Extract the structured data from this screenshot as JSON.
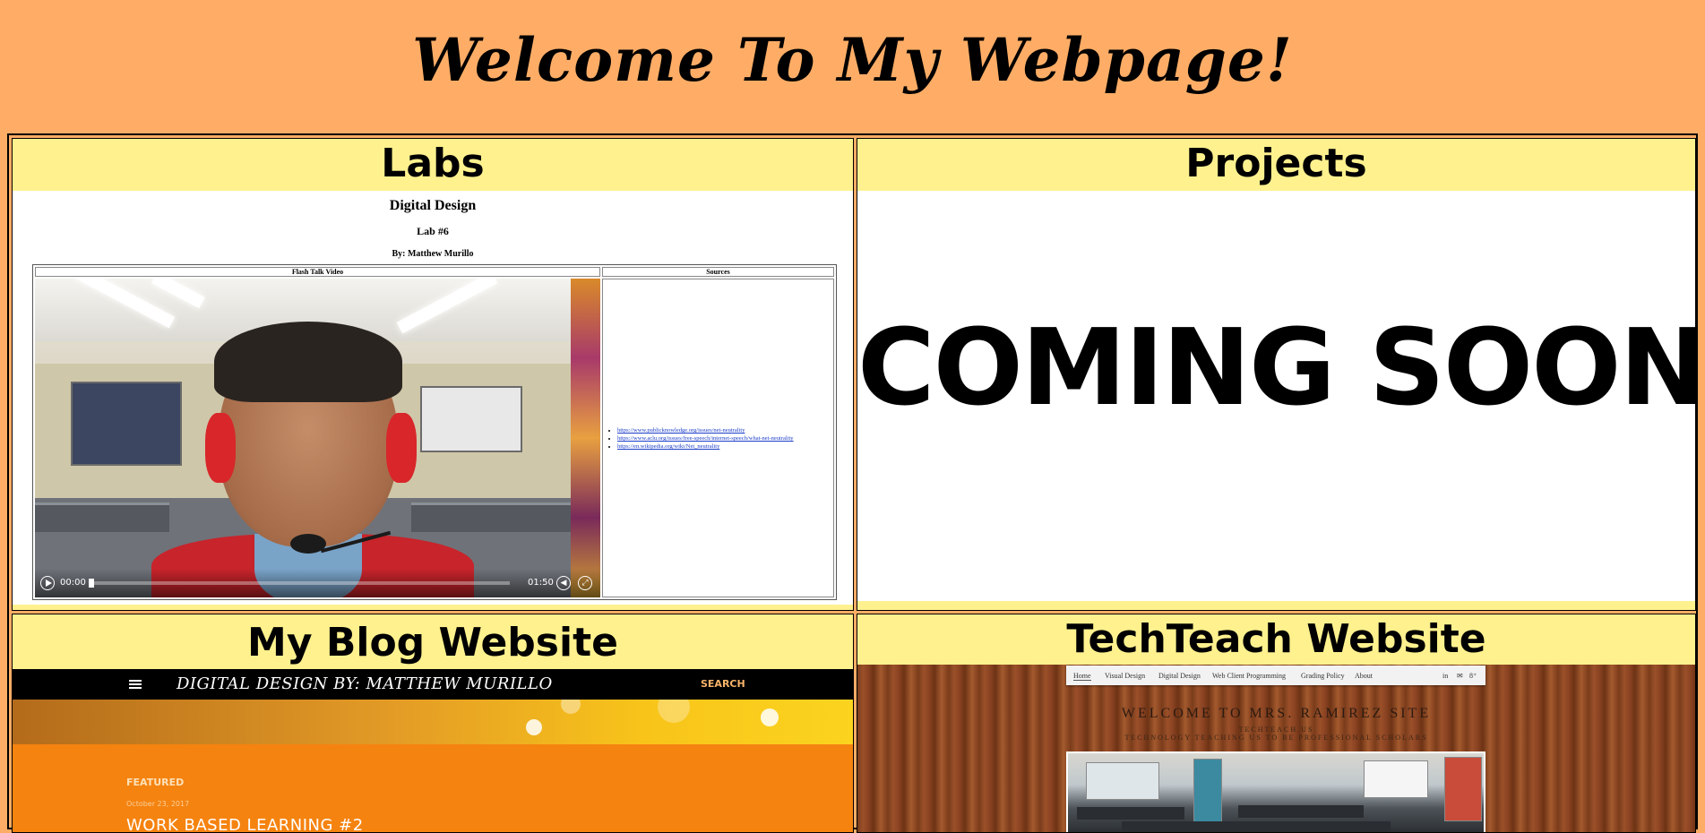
{
  "header": {
    "title": "Welcome To My Webpage!"
  },
  "cells": {
    "labs": {
      "title": "Labs"
    },
    "projects": {
      "title": "Projects"
    },
    "blog": {
      "title": "My Blog Website"
    },
    "techteach": {
      "title": "TechTeach Website"
    }
  },
  "labs_page": {
    "heading": "Digital Design",
    "subheading": "Lab #6",
    "author": "By: Matthew Murillo",
    "table": {
      "col1": "Flash Talk Video",
      "col2": "Sources"
    },
    "video": {
      "current_time": "00:00",
      "duration": "01:50",
      "progress": 0.0
    },
    "sources": [
      "https://www.publicknowledge.org/issues/net-neutrality",
      "https://www.aclu.org/issues/free-speech/internet-speech/what-net-neutrality",
      "https://en.wikipedia.org/wiki/Net_neutrality"
    ]
  },
  "projects_page": {
    "text": "COMING SOON"
  },
  "blog_page": {
    "site_title": "DIGITAL DESIGN BY: MATTHEW MURILLO",
    "search_label": "SEARCH",
    "featured_label": "FEATURED",
    "post_date": "October 23, 2017",
    "post_title": "WORK BASED LEARNING #2"
  },
  "techteach_page": {
    "nav": [
      "Home",
      "Visual Design",
      "Digital Design",
      "Web Client Programming",
      "Grading Policy",
      "About"
    ],
    "social": [
      "in",
      "✉",
      "8⁺"
    ],
    "welcome": "WELCOME TO MRS. RAMIREZ SITE",
    "sub1": "TECHTEACH.US",
    "sub2": "TECHNOLOGY TEACHING US TO BE PROFESSIONAL SCHOLARS"
  },
  "colors": {
    "page_bg": "#ffad66",
    "cell_bg": "#fff18e",
    "blog_orange": "#f58310",
    "link_blue": "#1a3cc8"
  }
}
